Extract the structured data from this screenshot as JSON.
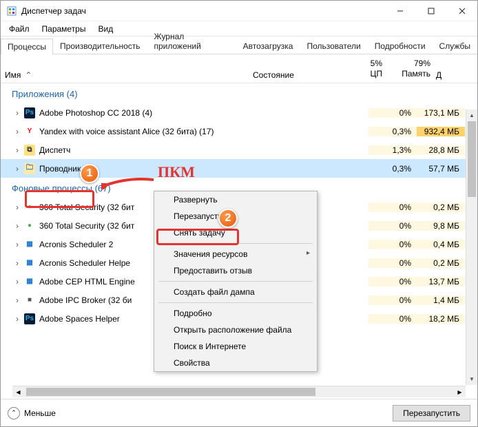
{
  "window": {
    "title": "Диспетчер задач"
  },
  "menu": {
    "file": "Файл",
    "options": "Параметры",
    "view": "Вид"
  },
  "tabs": [
    "Процессы",
    "Производительность",
    "Журнал приложений",
    "Автозагрузка",
    "Пользователи",
    "Подробности",
    "Службы"
  ],
  "columns": {
    "name": "Имя",
    "state": "Состояние",
    "cpu_pct": "5%",
    "cpu": "ЦП",
    "mem_pct": "79%",
    "mem": "Память",
    "extra": "Д"
  },
  "groups": {
    "apps": "Приложения (4)",
    "bg": "Фоновые процессы (67)"
  },
  "rows_apps": [
    {
      "icon": "Ps",
      "iconbg": "#001b33",
      "iconfg": "#29abe2",
      "name": "Adobe Photoshop CC 2018 (4)",
      "cpu": "0%",
      "mem": "173,1 МБ",
      "hot": false
    },
    {
      "icon": "Y",
      "iconbg": "#fff",
      "iconfg": "#ff0000",
      "name": "Yandex with voice assistant Alice (32 бита) (17)",
      "cpu": "0,3%",
      "mem": "932,4 МБ",
      "hot": true
    },
    {
      "icon": "⧉",
      "iconbg": "#fde282",
      "iconfg": "#333",
      "name": "Диспетч",
      "cpu": "1,3%",
      "mem": "28,8 МБ",
      "hot": false
    },
    {
      "icon": "🗀",
      "iconbg": "#ffe9a8",
      "iconfg": "#2962a8",
      "name": "Проводник",
      "cpu": "0,3%",
      "mem": "57,7 МБ",
      "hot": false,
      "selected": true
    }
  ],
  "rows_bg": [
    {
      "icon": "●",
      "iconbg": "#fff",
      "iconfg": "#4caf50",
      "name": "360 Total Security (32 бит",
      "cpu": "0%",
      "mem": "0,2 МБ"
    },
    {
      "icon": "●",
      "iconbg": "#fff",
      "iconfg": "#4caf50",
      "name": "360 Total Security (32 бит",
      "cpu": "0%",
      "mem": "9,8 МБ"
    },
    {
      "icon": "▦",
      "iconbg": "#fff",
      "iconfg": "#1976d2",
      "name": "Acronis Scheduler 2",
      "cpu": "0%",
      "mem": "0,4 МБ"
    },
    {
      "icon": "▦",
      "iconbg": "#fff",
      "iconfg": "#1976d2",
      "name": "Acronis Scheduler Helpe",
      "cpu": "0%",
      "mem": "0,2 МБ"
    },
    {
      "icon": "▦",
      "iconbg": "#fff",
      "iconfg": "#1976d2",
      "name": "Adobe CEP HTML Engine",
      "cpu": "0%",
      "mem": "13,7 МБ"
    },
    {
      "icon": "■",
      "iconbg": "#fff",
      "iconfg": "#555",
      "name": "Adobe IPC Broker (32 би",
      "cpu": "0%",
      "mem": "1,4 МБ"
    },
    {
      "icon": "Ps",
      "iconbg": "#001b33",
      "iconfg": "#29abe2",
      "name": "Adobe Spaces Helper",
      "cpu": "0%",
      "mem": "18,2 МБ"
    }
  ],
  "context_menu": [
    {
      "label": "Развернуть"
    },
    {
      "label": "Перезапустить"
    },
    {
      "label": "Снять задачу",
      "highlight": true
    },
    {
      "sep": true
    },
    {
      "label": "Значения ресурсов",
      "sub": true
    },
    {
      "label": "Предоставить отзыв"
    },
    {
      "sep": true
    },
    {
      "label": "Создать файл дампа"
    },
    {
      "sep": true
    },
    {
      "label": "Подробно"
    },
    {
      "label": "Открыть расположение файла"
    },
    {
      "label": "Поиск в Интернете"
    },
    {
      "label": "Свойства"
    }
  ],
  "footer": {
    "less": "Меньше",
    "restart": "Перезапустить"
  },
  "annotations": {
    "pkm": "ПКМ",
    "badge1": "1",
    "badge2": "2"
  }
}
